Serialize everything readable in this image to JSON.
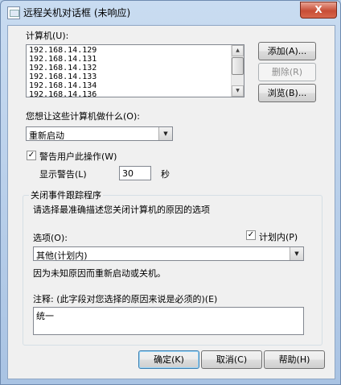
{
  "window": {
    "title": "远程关机对话框 (未响应)",
    "close_glyph": "X"
  },
  "computers": {
    "label": "计算机(U):",
    "items": [
      "192.168.14.129",
      "192.168.14.131",
      "192.168.14.132",
      "192.168.14.133",
      "192.168.14.134",
      "192.168.14.136"
    ],
    "add_label": "添加(A)...",
    "remove_label": "删除(R)",
    "browse_label": "浏览(B)..."
  },
  "action": {
    "label": "您想让这些计算机做什么(O):",
    "selected": "重新启动"
  },
  "warn": {
    "checkbox_label": "警告用户此操作(W)",
    "checked": true,
    "display_label": "显示警告(L)",
    "seconds_value": "30",
    "unit": "秒"
  },
  "tracker": {
    "group_title": "关闭事件跟踪程序",
    "instruction": "请选择最准确描述您关闭计算机的原因的选项",
    "option_label": "选项(O):",
    "planned_label": "计划内(P)",
    "planned_checked": true,
    "selected_option": "其他(计划内)",
    "description": "因为未知原因而重新启动或关机。",
    "comment_label": "注释: (此字段对您选择的原因来说是必须的)(E)",
    "comment_value": "统一"
  },
  "footer": {
    "ok_label": "确定(K)",
    "cancel_label": "取消(C)",
    "help_label": "帮助(H)"
  },
  "icons": {
    "check_glyph": "✓",
    "combo_arrow": "▼",
    "scroll_up": "▲",
    "scroll_down": "▼"
  }
}
